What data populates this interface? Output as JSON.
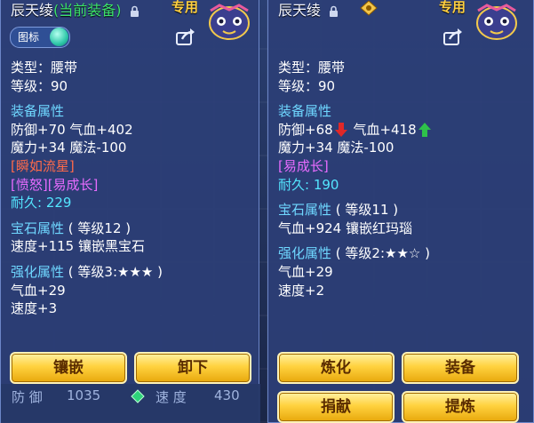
{
  "left": {
    "title": "辰天绫",
    "title_current": "(当前装备)",
    "zhuan": "专用",
    "toggle_label": "图标",
    "type": "类型：腰带",
    "level": "等级：90",
    "section_equip": "装备属性",
    "defense_qixue": "防御+70 气血+402",
    "moli_mofa": "魔力+34 魔法-100",
    "special_skill": "[瞬如流星]",
    "special_effect": "[愤怒][易成长]",
    "durability_label": "耐久:",
    "durability_value": "229",
    "section_gem": "宝石属性",
    "gem_level": "( 等级12 )",
    "gem_effect": "速度+115 镶嵌黑宝石",
    "section_enhance": "强化属性",
    "enhance_level": "( 等级3:★★★ )",
    "enhance_1": "气血+29",
    "enhance_2": "速度+3",
    "btn_inlay": "镶嵌",
    "btn_unequip": "卸下",
    "bottom_fangyu": "防 御",
    "bottom_fangyu_val": "1035",
    "bottom_sudu": "速 度",
    "bottom_sudu_val": "430"
  },
  "right": {
    "title": "辰天绫",
    "zhuan": "专用",
    "type": "类型：腰带",
    "level": "等级：90",
    "section_equip": "装备属性",
    "defense": "防御+68",
    "qixue": "气血+418",
    "moli_mofa": "魔力+34 魔法-100",
    "special_effect": "[易成长]",
    "durability_label": "耐久:",
    "durability_value": "190",
    "section_gem": "宝石属性",
    "gem_level": "( 等级11 )",
    "gem_effect": "气血+924 镶嵌红玛瑙",
    "section_enhance": "强化属性",
    "enhance_level": "( 等级2:★★☆ )",
    "enhance_1": "气血+29",
    "enhance_2": "速度+2",
    "btn_refine": "炼化",
    "btn_equip": "装备",
    "btn_donate": "捐献",
    "btn_upgrade": "提炼"
  },
  "colors": {
    "section": "#6fd7ff",
    "current_equip": "#3ce26b",
    "special_red": "#ff6a4a",
    "special_pink": "#e86cff",
    "durability": "#54e6ff",
    "arrow_down": "#e02828",
    "arrow_up": "#2ec24a",
    "button_gold": "#ffd23f"
  },
  "icons": {
    "lock": "lock-icon",
    "share": "share-icon",
    "arrow_down": "arrow-down-icon",
    "arrow_up": "arrow-up-icon",
    "compare_badge": "compare-badge-icon"
  }
}
